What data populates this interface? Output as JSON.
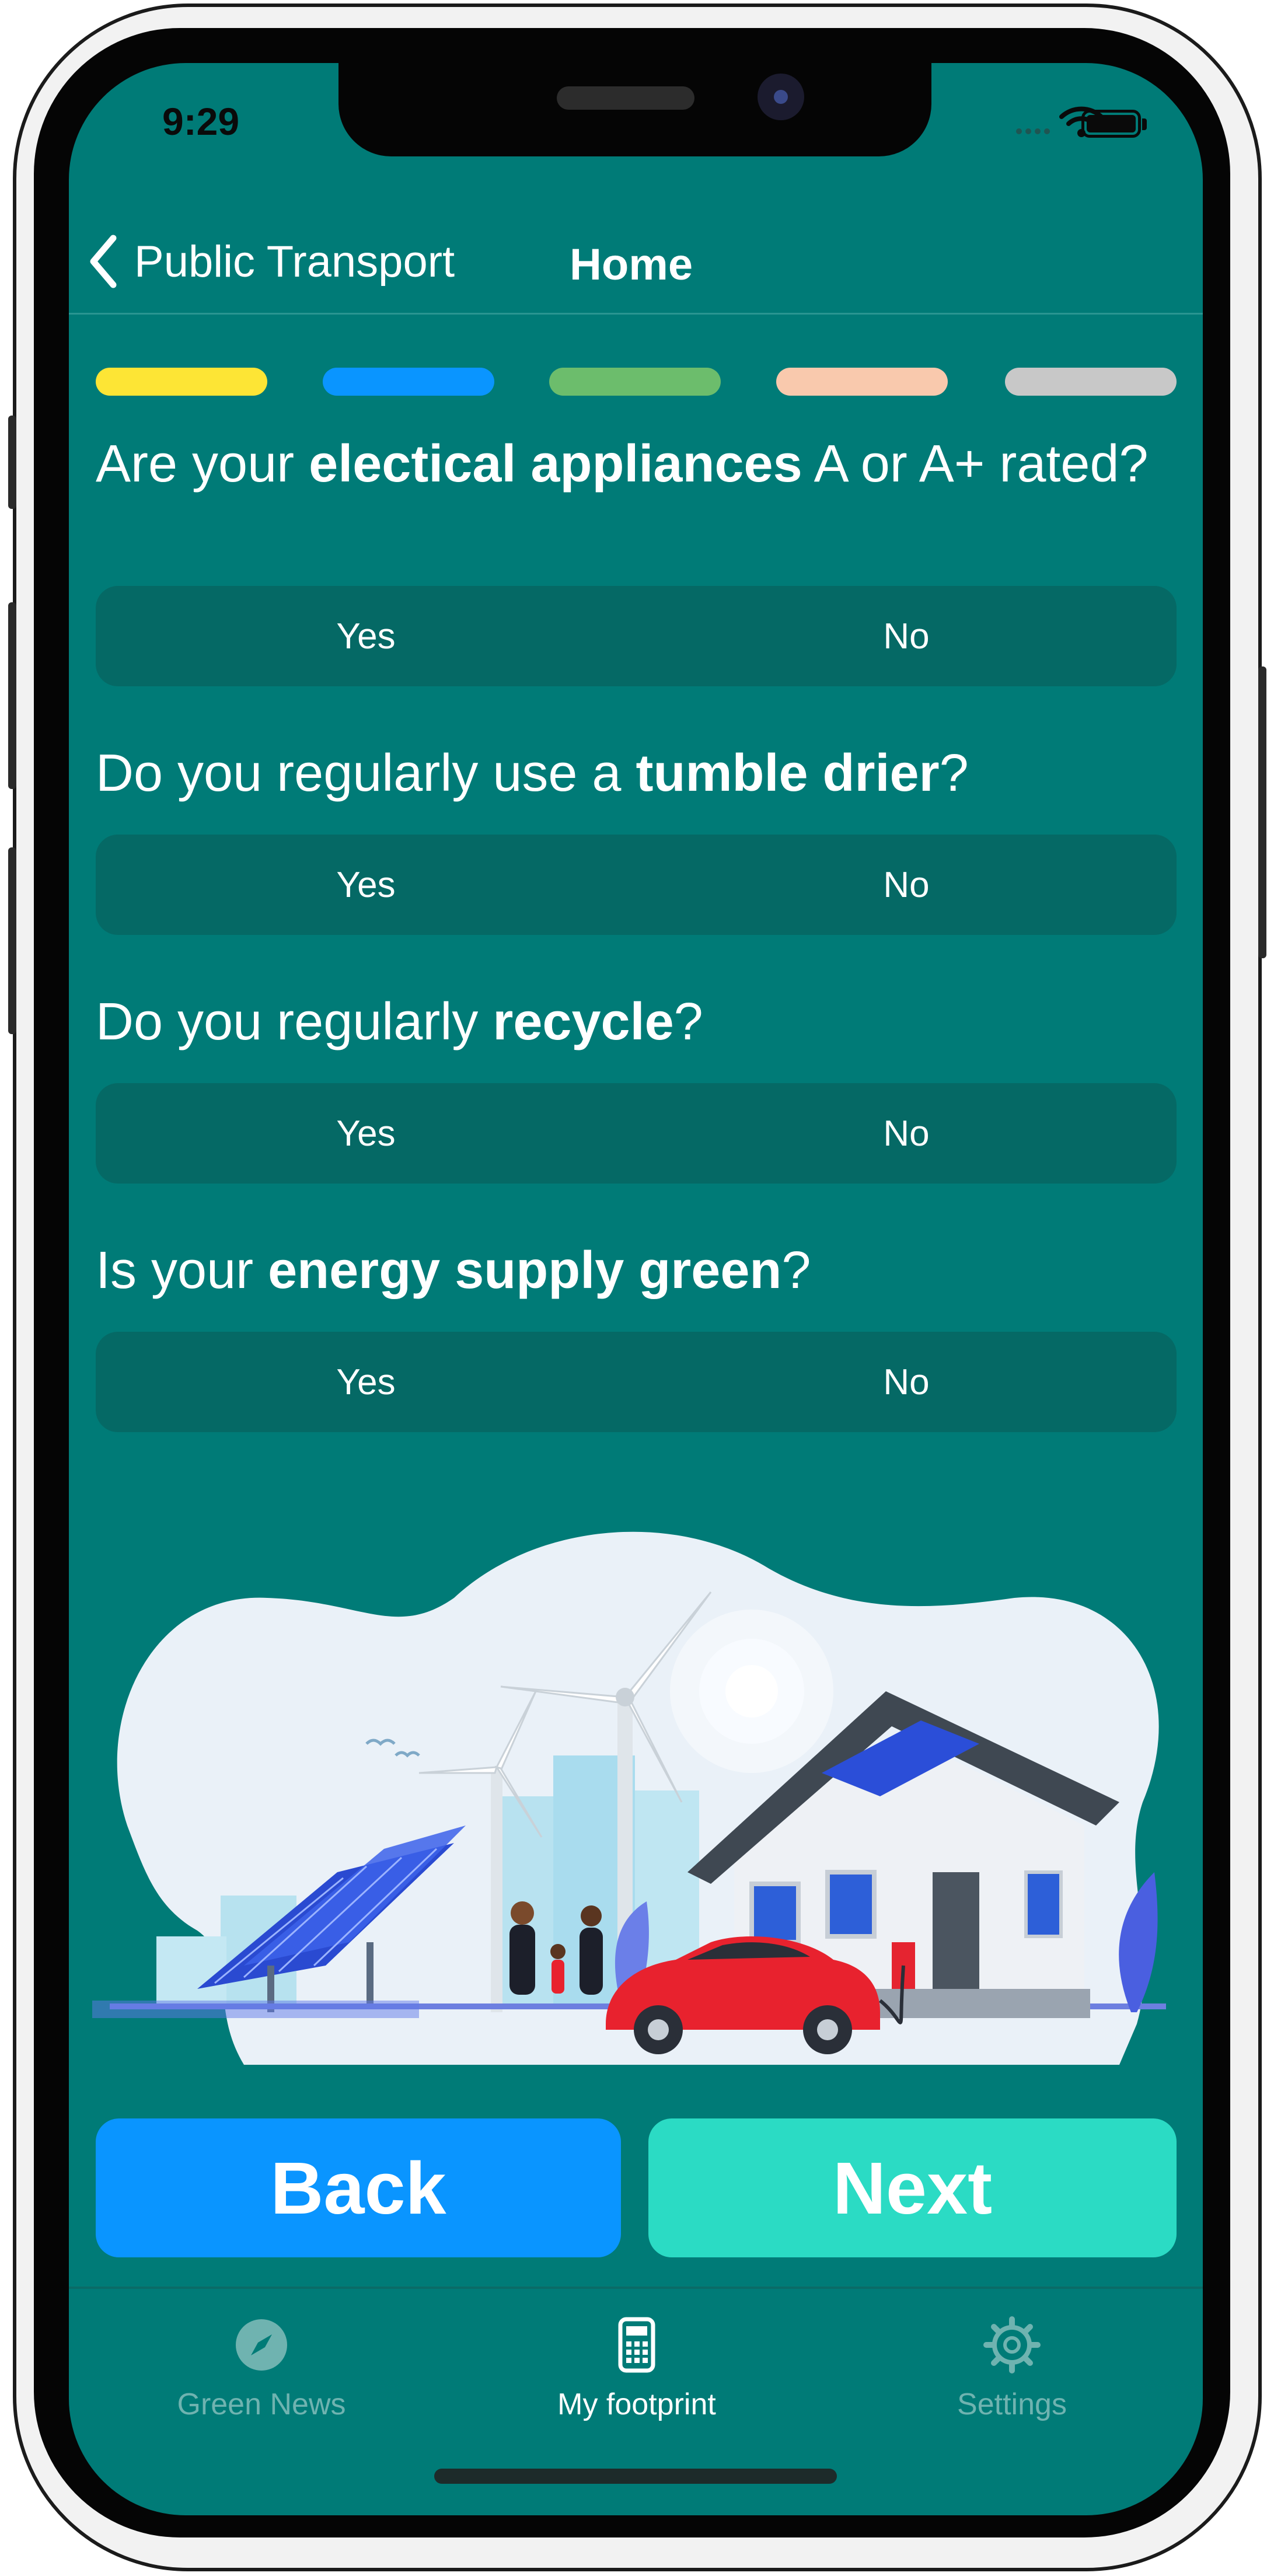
{
  "status_bar": {
    "time": "9:29"
  },
  "nav": {
    "back_label": "Public Transport",
    "title": "Home"
  },
  "progress": {
    "segment_colors": [
      "#fde535",
      "#0a95ff",
      "#6cbd6c",
      "#f9c9ad",
      "#c8c8c8"
    ]
  },
  "questions": [
    {
      "prefix": "Are your ",
      "bold": "electical appliances",
      "suffix": " A or A+ rated?",
      "yes": "Yes",
      "no": "No"
    },
    {
      "prefix": "Do you regularly use a ",
      "bold": "tumble drier",
      "suffix": "?",
      "yes": "Yes",
      "no": "No"
    },
    {
      "prefix": "Do you regularly ",
      "bold": "recycle",
      "suffix": "?",
      "yes": "Yes",
      "no": "No"
    },
    {
      "prefix": "Is your ",
      "bold": "energy supply green",
      "suffix": "?",
      "yes": "Yes",
      "no": "No"
    }
  ],
  "actions": {
    "back": "Back",
    "next": "Next"
  },
  "tabbar": {
    "items": [
      {
        "label": "Green News",
        "icon": "compass-icon",
        "active": false
      },
      {
        "label": "My footprint",
        "icon": "calculator-icon",
        "active": true
      },
      {
        "label": "Settings",
        "icon": "gear-icon",
        "active": false
      }
    ]
  },
  "colors": {
    "background": "#007b77",
    "segment": "#056965",
    "back_button": "#0a95ff",
    "next_button": "#2bdbc4",
    "tab_active": "#ffffff",
    "tab_inactive": "#6fb3b0"
  }
}
